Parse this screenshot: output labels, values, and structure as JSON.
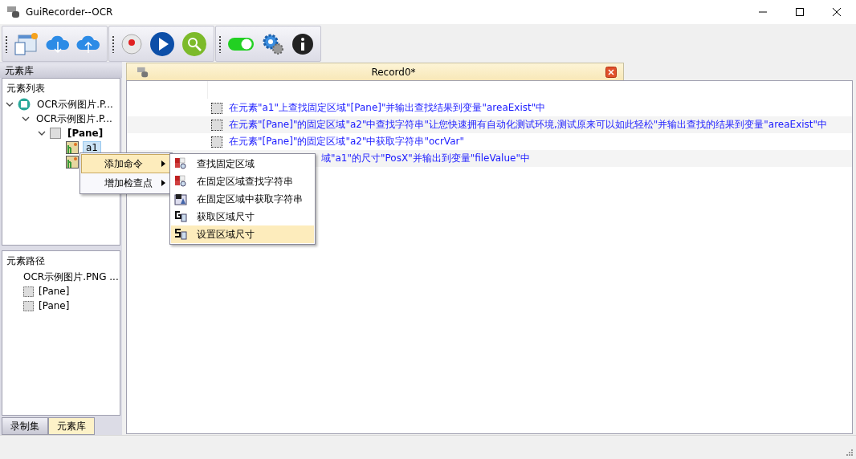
{
  "window": {
    "title": "GuiRecorder--OCR"
  },
  "toolbar": {
    "toggle_on": true
  },
  "left_panel": {
    "title": "元素库",
    "tree": {
      "heading": "元素列表",
      "items": [
        {
          "label": "OCR示例图片.P...",
          "kind": "app",
          "expanded": true,
          "selected": false,
          "children": [
            {
              "label": "OCR示例图片.P...",
              "expanded": true,
              "selected": false,
              "children": [
                {
                  "label": "[Pane]",
                  "kind": "pane",
                  "expanded": true,
                  "selected": false,
                  "children": [
                    {
                      "label": "a1",
                      "kind": "element",
                      "selected": true
                    },
                    {
                      "kind": "element",
                      "selected": false
                    }
                  ]
                }
              ]
            }
          ]
        }
      ]
    },
    "path": {
      "heading": "元素路径",
      "items": [
        {
          "label": "OCR示例图片.PNG ..."
        },
        {
          "label": "[Pane]",
          "kind": "pane"
        },
        {
          "label": "[Pane]",
          "kind": "pane"
        }
      ]
    }
  },
  "bottom_tabs": [
    {
      "label": "录制集",
      "selected": false
    },
    {
      "label": "元素库",
      "selected": true
    }
  ],
  "document": {
    "tab": "Record0*",
    "rows": [
      {
        "kind": "full",
        "checked": false,
        "text": "在元素\"a1\"上查找固定区域\"[Pane]\"并输出查找结果到变量\"areaExist\"中"
      },
      {
        "kind": "full",
        "checked": false,
        "text": "在元素\"[Pane]\"的固定区域\"a2\"中查找字符串\"让您快速拥有自动化测试环境,测试原来可以如此轻松\"并输出查找的结果到变量\"areaExist\"中"
      },
      {
        "kind": "full",
        "checked": false,
        "text": "在元素\"[Pane]\"的固定区域\"a2\"中获取字符串\"ocrVar\""
      },
      {
        "kind": "covered",
        "text": "域\"a1\"的尺寸\"PosX\"并输出到变量\"fileValue\"中"
      }
    ]
  },
  "context_menu": {
    "items": [
      {
        "label": "添加命令",
        "selected": true
      },
      {
        "label": "增加检查点",
        "selected": false
      }
    ],
    "submenu": [
      {
        "label": "查找固定区域",
        "kind": "find",
        "selected": false
      },
      {
        "label": "在固定区域查找字符串",
        "kind": "find-string",
        "selected": false
      },
      {
        "label": "在固定区域中获取字符串",
        "kind": "get-string",
        "selected": false
      },
      {
        "label": "获取区域尺寸",
        "kind": "get-size",
        "selected": false
      },
      {
        "label": "设置区域尺寸",
        "kind": "set-size",
        "selected": true
      }
    ]
  }
}
